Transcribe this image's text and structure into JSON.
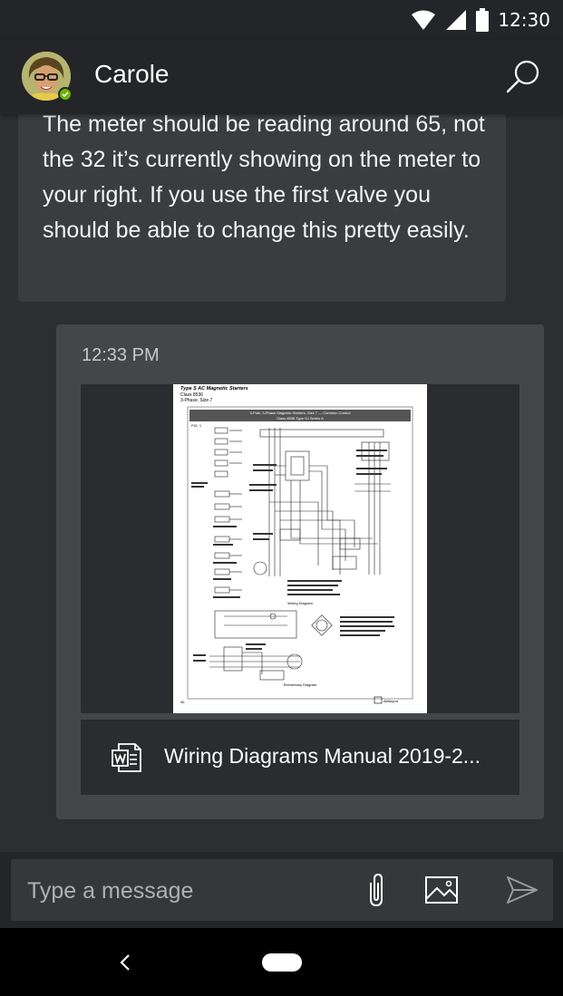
{
  "status_bar": {
    "time": "12:30"
  },
  "header": {
    "contact_name": "Carole",
    "presence": "available"
  },
  "messages": [
    {
      "text": "The meter should be reading around 65, not the 32 it’s currently showing on the meter to your right. If you use the first valve you should be able to change this pretty easily."
    }
  ],
  "attachment_card": {
    "timestamp": "12:33 PM",
    "file_name": "Wiring Diagrams Manual 2019-2...",
    "file_type_icon": "word-icon",
    "document_preview": {
      "heading": "Type S AC Magnetic Starters",
      "subheading_1": "Class 8536",
      "subheading_2": "3-Phase, Size 7",
      "banner_line_1": "3-Pole, 3-Phase Magnetic Starters, Size 7 — Common Control",
      "banner_line_2": "Class 8536 Type SJ Series A",
      "fig_label": "FIG. 1",
      "wiring_caption": "Wiring Diagram",
      "elementary_caption": "Elementary Diagram",
      "page_number": "46",
      "brand": "AllAbyrut"
    }
  },
  "composer": {
    "placeholder": "Type a message"
  },
  "colors": {
    "background": "#2d2e31",
    "bar": "#242528",
    "bubble": "#3b3c40",
    "card": "#45464a",
    "presence": "#6bb700"
  }
}
